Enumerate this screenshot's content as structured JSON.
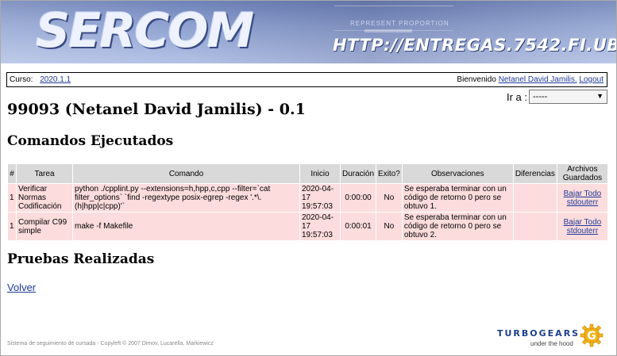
{
  "banner": {
    "logo": "SERCOM",
    "url": "HTTP://ENTREGAS.7542.FI.UBA.AR",
    "deco": "REPRESENT PROPORTION"
  },
  "userbar": {
    "curso_label": "Curso:",
    "curso_value": "2020.1.1",
    "welcome": "Bienvenido",
    "user": "Netanel David Jamilis.",
    "logout": "Logout"
  },
  "goto": {
    "label": "Ir a :",
    "selected": "-----"
  },
  "title": "99093 (Netanel David Jamilis) - 0.1",
  "section_comandos": "Comandos Ejecutados",
  "table": {
    "headers": [
      "#",
      "Tarea",
      "Comando",
      "Inicio",
      "Duración",
      "Exito?",
      "Observaciones",
      "Diferencias",
      "Archivos Guardados"
    ],
    "rows": [
      {
        "num": "1",
        "tarea": "Verificar Normas Codificación",
        "comando": "python ./cpplint.py --extensions=h,hpp,c,cpp --filter=`cat filter_options` `find -regextype posix-egrep -regex '.*\\.(h|hpp|c|cpp)'`",
        "inicio": "2020-04-17 19:57:03",
        "duracion": "0:00:00",
        "exito": "No",
        "observaciones": "Se esperaba terminar con un código de retorno 0 pero se obtuvo 1.",
        "diferencias": "",
        "archivos": [
          "Bajar Todo",
          "stdouterr"
        ]
      },
      {
        "num": "1",
        "tarea": "Compilar C99 simple",
        "comando": "make -f Makefile",
        "inicio": "2020-04-17 19:57:03",
        "duracion": "0:00:01",
        "exito": "No",
        "observaciones": "Se esperaba terminar con un código de retorno 0 pero se obtuvo 2.",
        "diferencias": "",
        "archivos": [
          "Bajar Todo",
          "stdouterr"
        ]
      }
    ]
  },
  "section_pruebas": "Pruebas Realizadas",
  "volver": "Volver",
  "footer": "Sistema de seguimiento de cursada - Copyleft © 2007 Dimov, Lucarella, Markiewicz",
  "turbogears": {
    "word": "TURBOGEARS",
    "tagline": "under the hood",
    "gear_letter": "G"
  }
}
